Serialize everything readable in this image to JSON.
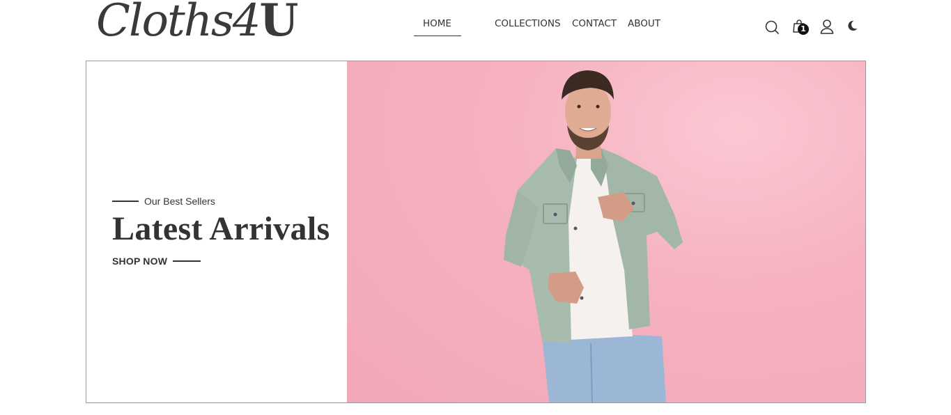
{
  "brand": {
    "logo_main": "Cloths4",
    "logo_bold": "U"
  },
  "nav": {
    "items": [
      {
        "label": "HOME",
        "active": true
      },
      {
        "label": "COLLECTIONS"
      },
      {
        "label": "CONTACT"
      },
      {
        "label": "ABOUT"
      }
    ]
  },
  "header_icons": {
    "search": "search-icon",
    "cart": "shopping-bag-icon",
    "cart_count": "1",
    "user": "user-icon",
    "theme": "moon-icon"
  },
  "hero": {
    "eyebrow": "Our Best Sellers",
    "title": "Latest Arrivals",
    "cta": "SHOP NOW"
  },
  "colors": {
    "accent": "#333333",
    "hero_background": "#f4acbb",
    "jacket": "#a8bcae",
    "jeans": "#9cb6d6"
  }
}
